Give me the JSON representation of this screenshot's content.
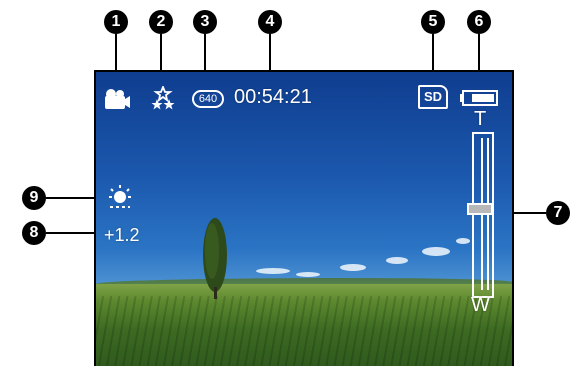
{
  "callouts": [
    "❶",
    "❷",
    "❸",
    "❹",
    "❺",
    "❻",
    "❼",
    "❽",
    "❾"
  ],
  "callout_numbers": [
    "1",
    "2",
    "3",
    "4",
    "5",
    "6",
    "7",
    "8",
    "9"
  ],
  "hud": {
    "resolution_badge": "640",
    "recording_time": "00:54:21",
    "storage_badge": "SD",
    "zoom_tele_label": "T",
    "zoom_wide_label": "W",
    "exposure_value": "+1.2"
  },
  "icons": {
    "mode": "video-camera-icon",
    "scene": "sparkle-stars-icon",
    "resolution": "resolution-640-icon",
    "storage": "sd-card-icon",
    "battery": "battery-icon",
    "white_balance": "sun-daylight-icon"
  },
  "battery_level": 0.7,
  "colors": {
    "hud": "#ffffff",
    "callout_bg": "#000000"
  }
}
